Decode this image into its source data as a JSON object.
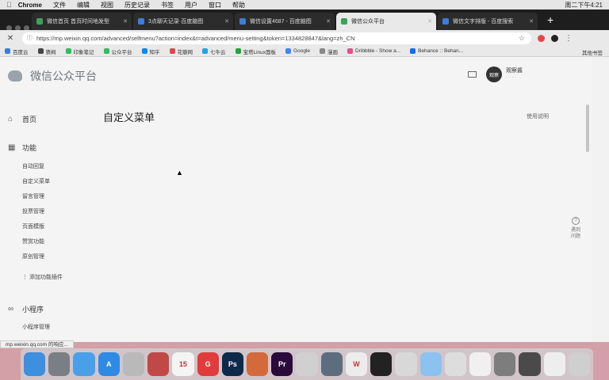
{
  "menubar": {
    "app": "Chrome",
    "items": [
      "文件",
      "编辑",
      "视图",
      "历史记录",
      "书签",
      "用户",
      "窗口",
      "帮助"
    ],
    "clock": "周二下午4:21"
  },
  "tabs": [
    {
      "label": "微信首页 首页时间地发型",
      "active": false
    },
    {
      "label": "3点聊天记录·百度脑图",
      "active": false
    },
    {
      "label": "微信设置4687 - 百度脑图",
      "active": false
    },
    {
      "label": "微信公众平台",
      "active": true
    },
    {
      "label": "微信文字排版 - 百度搜索",
      "active": false
    }
  ],
  "address": {
    "url": "https://mp.weixin.qq.com/advanced/selfmenu?action=index&t=advanced/menu-setting&token=1334828847&lang=zh_CN"
  },
  "bookmarks": {
    "items": [
      {
        "label": "百度云",
        "color": "#3b7ddd"
      },
      {
        "label": "猜拇",
        "color": "#444444"
      },
      {
        "label": "印象笔记",
        "color": "#2dbe60"
      },
      {
        "label": "公众平台",
        "color": "#2dbe60"
      },
      {
        "label": "知乎",
        "color": "#0f88eb"
      },
      {
        "label": "花瓣网",
        "color": "#e5454e"
      },
      {
        "label": "七牛云",
        "color": "#1fa5e0"
      },
      {
        "label": "宝塔Linux面板",
        "color": "#20a53a"
      },
      {
        "label": "Google",
        "color": "#4285f4"
      },
      {
        "label": "漫画",
        "color": "#888888"
      },
      {
        "label": "Dribbble - Show a...",
        "color": "#ea4c89"
      },
      {
        "label": "Behance :: Behan...",
        "color": "#1769ff"
      }
    ],
    "others": "其他书签"
  },
  "header": {
    "brand": "微信公众平台",
    "avatar_text": "观察",
    "account_name": "观察酱",
    "account_sub": "· · · ·"
  },
  "sidebar": {
    "home": "首页",
    "features": "功能",
    "feature_items": [
      "自动回复",
      "自定义菜单",
      "留言管理",
      "投票管理",
      "页面模版",
      "赞赏功能",
      "原创管理"
    ],
    "add_plugin": "添加功能插件",
    "miniprogram": "小程序",
    "mini_items": [
      "小程序管理"
    ]
  },
  "main": {
    "title": "自定义菜单",
    "doc_link": "使用说明"
  },
  "helper": {
    "q": "?",
    "label": "遇到问题"
  },
  "status": {
    "text": "mp.weixin.qq.com 的响应..."
  },
  "dock": {
    "icons": [
      {
        "name": "finder",
        "color": "#3d8fe0",
        "label": ""
      },
      {
        "name": "launchpad",
        "color": "#7a7f86",
        "label": ""
      },
      {
        "name": "safari",
        "color": "#4aa0e8",
        "label": ""
      },
      {
        "name": "appstore",
        "color": "#2f8ae6",
        "label": "A"
      },
      {
        "name": "photos",
        "color": "#b9b9b9",
        "label": ""
      },
      {
        "name": "pen",
        "color": "#c24848",
        "label": ""
      },
      {
        "name": "calendar",
        "color": "#f4f4f4",
        "label": "15"
      },
      {
        "name": "todo",
        "color": "#e23b3b",
        "label": "G"
      },
      {
        "name": "photoshop",
        "color": "#0d2a4a",
        "label": "Ps"
      },
      {
        "name": "sketch",
        "color": "#d46a3a",
        "label": ""
      },
      {
        "name": "premiere",
        "color": "#2a0a3a",
        "label": "Pr"
      },
      {
        "name": "keynote",
        "color": "#d0d0d0",
        "label": ""
      },
      {
        "name": "chrome",
        "color": "#5d6d7e",
        "label": ""
      },
      {
        "name": "wps",
        "color": "#ececec",
        "label": "W"
      },
      {
        "name": "qq",
        "color": "#222222",
        "label": ""
      },
      {
        "name": "wechat",
        "color": "#d8d8d8",
        "label": ""
      },
      {
        "name": "messages",
        "color": "#8cc2f0",
        "label": ""
      },
      {
        "name": "preview",
        "color": "#dddddd",
        "label": ""
      },
      {
        "name": "baidu",
        "color": "#f0f0f0",
        "label": ""
      },
      {
        "name": "settings",
        "color": "#7d7d7d",
        "label": ""
      },
      {
        "name": "quicktime",
        "color": "#4a4a4a",
        "label": ""
      },
      {
        "name": "music",
        "color": "#eeeeee",
        "label": ""
      },
      {
        "name": "trash",
        "color": "#cfcfcf",
        "label": ""
      }
    ]
  }
}
